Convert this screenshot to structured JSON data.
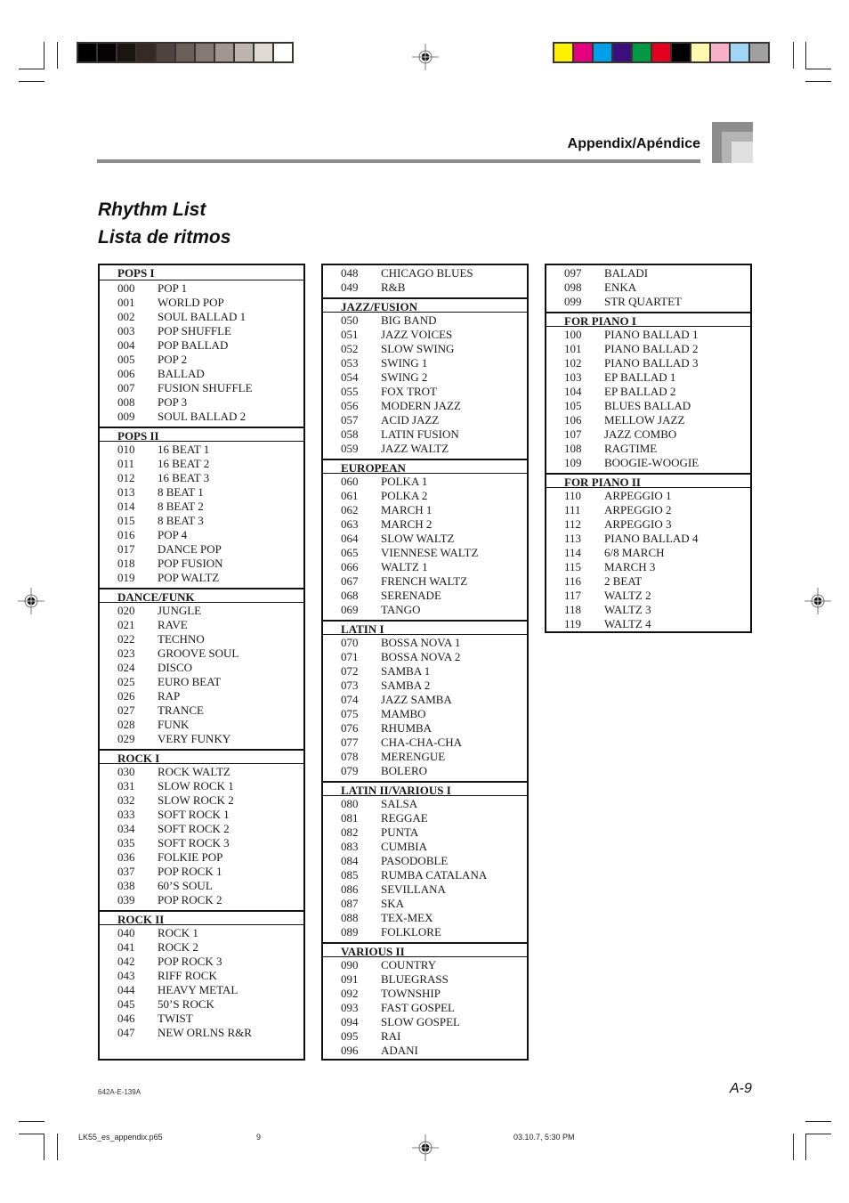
{
  "header": {
    "section": "Appendix/Apéndice",
    "title_en": "Rhythm List",
    "title_es": "Lista de ritmos"
  },
  "colors": {
    "grayscale_bar": [
      "#000000",
      "#050304",
      "#1c1613",
      "#362a26",
      "#4f4440",
      "#6b5f5a",
      "#857974",
      "#a1958f",
      "#bfb5b0",
      "#e0dad6",
      "#ffffff"
    ],
    "process_bar": [
      "#fff100",
      "#e4007f",
      "#00a0e9",
      "#3d0f7e",
      "#009944",
      "#e60020",
      "#000000",
      "#fff9b0",
      "#f8b0c8",
      "#a0d6f5",
      "#a0a0a0"
    ],
    "header_rule": "#8c8c8c"
  },
  "columns": [
    {
      "sections": [
        {
          "heading": "POPS I",
          "items": [
            {
              "num": "000",
              "name": "POP 1"
            },
            {
              "num": "001",
              "name": "WORLD POP"
            },
            {
              "num": "002",
              "name": "SOUL BALLAD 1"
            },
            {
              "num": "003",
              "name": "POP SHUFFLE"
            },
            {
              "num": "004",
              "name": "POP BALLAD"
            },
            {
              "num": "005",
              "name": "POP 2"
            },
            {
              "num": "006",
              "name": "BALLAD"
            },
            {
              "num": "007",
              "name": "FUSION SHUFFLE"
            },
            {
              "num": "008",
              "name": "POP 3"
            },
            {
              "num": "009",
              "name": "SOUL BALLAD 2"
            }
          ]
        },
        {
          "heading": "POPS II",
          "items": [
            {
              "num": "010",
              "name": "16 BEAT 1"
            },
            {
              "num": "011",
              "name": "16 BEAT 2"
            },
            {
              "num": "012",
              "name": "16 BEAT 3"
            },
            {
              "num": "013",
              "name": "8 BEAT 1"
            },
            {
              "num": "014",
              "name": "8 BEAT 2"
            },
            {
              "num": "015",
              "name": "8 BEAT 3"
            },
            {
              "num": "016",
              "name": "POP 4"
            },
            {
              "num": "017",
              "name": "DANCE POP"
            },
            {
              "num": "018",
              "name": "POP FUSION"
            },
            {
              "num": "019",
              "name": "POP WALTZ"
            }
          ]
        },
        {
          "heading": "DANCE/FUNK",
          "items": [
            {
              "num": "020",
              "name": "JUNGLE"
            },
            {
              "num": "021",
              "name": "RAVE"
            },
            {
              "num": "022",
              "name": "TECHNO"
            },
            {
              "num": "023",
              "name": "GROOVE SOUL"
            },
            {
              "num": "024",
              "name": "DISCO"
            },
            {
              "num": "025",
              "name": "EURO BEAT"
            },
            {
              "num": "026",
              "name": "RAP"
            },
            {
              "num": "027",
              "name": "TRANCE"
            },
            {
              "num": "028",
              "name": "FUNK"
            },
            {
              "num": "029",
              "name": "VERY FUNKY"
            }
          ]
        },
        {
          "heading": "ROCK I",
          "items": [
            {
              "num": "030",
              "name": "ROCK WALTZ"
            },
            {
              "num": "031",
              "name": "SLOW ROCK 1"
            },
            {
              "num": "032",
              "name": "SLOW ROCK 2"
            },
            {
              "num": "033",
              "name": "SOFT ROCK 1"
            },
            {
              "num": "034",
              "name": "SOFT ROCK 2"
            },
            {
              "num": "035",
              "name": "SOFT ROCK 3"
            },
            {
              "num": "036",
              "name": "FOLKIE POP"
            },
            {
              "num": "037",
              "name": "POP ROCK 1"
            },
            {
              "num": "038",
              "name": "60’S SOUL"
            },
            {
              "num": "039",
              "name": "POP ROCK 2"
            }
          ]
        },
        {
          "heading": "ROCK II",
          "items": [
            {
              "num": "040",
              "name": "ROCK 1"
            },
            {
              "num": "041",
              "name": "ROCK 2"
            },
            {
              "num": "042",
              "name": "POP ROCK 3"
            },
            {
              "num": "043",
              "name": "RIFF ROCK"
            },
            {
              "num": "044",
              "name": "HEAVY METAL"
            },
            {
              "num": "045",
              "name": "50’S ROCK"
            },
            {
              "num": "046",
              "name": "TWIST"
            },
            {
              "num": "047",
              "name": "NEW ORLNS R&R"
            }
          ]
        }
      ]
    },
    {
      "sections": [
        {
          "heading": "",
          "items": [
            {
              "num": "048",
              "name": "CHICAGO BLUES"
            },
            {
              "num": "049",
              "name": "R&B"
            }
          ]
        },
        {
          "heading": "JAZZ/FUSION",
          "items": [
            {
              "num": "050",
              "name": "BIG BAND"
            },
            {
              "num": "051",
              "name": "JAZZ VOICES"
            },
            {
              "num": "052",
              "name": "SLOW SWING"
            },
            {
              "num": "053",
              "name": "SWING 1"
            },
            {
              "num": "054",
              "name": "SWING 2"
            },
            {
              "num": "055",
              "name": "FOX TROT"
            },
            {
              "num": "056",
              "name": "MODERN JAZZ"
            },
            {
              "num": "057",
              "name": "ACID JAZZ"
            },
            {
              "num": "058",
              "name": "LATIN FUSION"
            },
            {
              "num": "059",
              "name": "JAZZ WALTZ"
            }
          ]
        },
        {
          "heading": "EUROPEAN",
          "items": [
            {
              "num": "060",
              "name": "POLKA 1"
            },
            {
              "num": "061",
              "name": "POLKA 2"
            },
            {
              "num": "062",
              "name": "MARCH 1"
            },
            {
              "num": "063",
              "name": "MARCH 2"
            },
            {
              "num": "064",
              "name": "SLOW WALTZ"
            },
            {
              "num": "065",
              "name": "VIENNESE WALTZ"
            },
            {
              "num": "066",
              "name": "WALTZ 1"
            },
            {
              "num": "067",
              "name": "FRENCH WALTZ"
            },
            {
              "num": "068",
              "name": "SERENADE"
            },
            {
              "num": "069",
              "name": "TANGO"
            }
          ]
        },
        {
          "heading": "LATIN I",
          "items": [
            {
              "num": "070",
              "name": "BOSSA NOVA 1"
            },
            {
              "num": "071",
              "name": "BOSSA NOVA 2"
            },
            {
              "num": "072",
              "name": "SAMBA 1"
            },
            {
              "num": "073",
              "name": "SAMBA 2"
            },
            {
              "num": "074",
              "name": "JAZZ SAMBA"
            },
            {
              "num": "075",
              "name": "MAMBO"
            },
            {
              "num": "076",
              "name": "RHUMBA"
            },
            {
              "num": "077",
              "name": "CHA-CHA-CHA"
            },
            {
              "num": "078",
              "name": "MERENGUE"
            },
            {
              "num": "079",
              "name": "BOLERO"
            }
          ]
        },
        {
          "heading": "LATIN II/VARIOUS I",
          "items": [
            {
              "num": "080",
              "name": "SALSA"
            },
            {
              "num": "081",
              "name": "REGGAE"
            },
            {
              "num": "082",
              "name": "PUNTA"
            },
            {
              "num": "083",
              "name": "CUMBIA"
            },
            {
              "num": "084",
              "name": "PASODOBLE"
            },
            {
              "num": "085",
              "name": "RUMBA CATALANA"
            },
            {
              "num": "086",
              "name": "SEVILLANA"
            },
            {
              "num": "087",
              "name": "SKA"
            },
            {
              "num": "088",
              "name": "TEX-MEX"
            },
            {
              "num": "089",
              "name": "FOLKLORE"
            }
          ]
        },
        {
          "heading": "VARIOUS II",
          "items": [
            {
              "num": "090",
              "name": "COUNTRY"
            },
            {
              "num": "091",
              "name": "BLUEGRASS"
            },
            {
              "num": "092",
              "name": "TOWNSHIP"
            },
            {
              "num": "093",
              "name": "FAST GOSPEL"
            },
            {
              "num": "094",
              "name": "SLOW GOSPEL"
            },
            {
              "num": "095",
              "name": "RAI"
            },
            {
              "num": "096",
              "name": "ADANI"
            }
          ]
        }
      ]
    },
    {
      "sections": [
        {
          "heading": "",
          "items": [
            {
              "num": "097",
              "name": "BALADI"
            },
            {
              "num": "098",
              "name": "ENKA"
            },
            {
              "num": "099",
              "name": "STR QUARTET"
            }
          ]
        },
        {
          "heading": "FOR PIANO I",
          "items": [
            {
              "num": "100",
              "name": "PIANO BALLAD 1"
            },
            {
              "num": "101",
              "name": "PIANO BALLAD 2"
            },
            {
              "num": "102",
              "name": "PIANO BALLAD 3"
            },
            {
              "num": "103",
              "name": "EP BALLAD 1"
            },
            {
              "num": "104",
              "name": "EP BALLAD 2"
            },
            {
              "num": "105",
              "name": "BLUES BALLAD"
            },
            {
              "num": "106",
              "name": "MELLOW JAZZ"
            },
            {
              "num": "107",
              "name": "JAZZ COMBO"
            },
            {
              "num": "108",
              "name": "RAGTIME"
            },
            {
              "num": "109",
              "name": "BOOGIE-WOOGIE"
            }
          ]
        },
        {
          "heading": "FOR PIANO II",
          "items": [
            {
              "num": "110",
              "name": "ARPEGGIO 1"
            },
            {
              "num": "111",
              "name": "ARPEGGIO 2"
            },
            {
              "num": "112",
              "name": "ARPEGGIO 3"
            },
            {
              "num": "113",
              "name": "PIANO BALLAD 4"
            },
            {
              "num": "114",
              "name": "6/8 MARCH"
            },
            {
              "num": "115",
              "name": "MARCH 3"
            },
            {
              "num": "116",
              "name": "2 BEAT"
            },
            {
              "num": "117",
              "name": "WALTZ 2"
            },
            {
              "num": "118",
              "name": "WALTZ 3"
            },
            {
              "num": "119",
              "name": "WALTZ 4"
            }
          ]
        }
      ]
    }
  ],
  "footer": {
    "code": "642A-E-139A",
    "page": "A-9",
    "slug_file": "LK55_es_appendix.p65",
    "slug_page": "9",
    "slug_date": "03.10.7, 5:30 PM"
  }
}
